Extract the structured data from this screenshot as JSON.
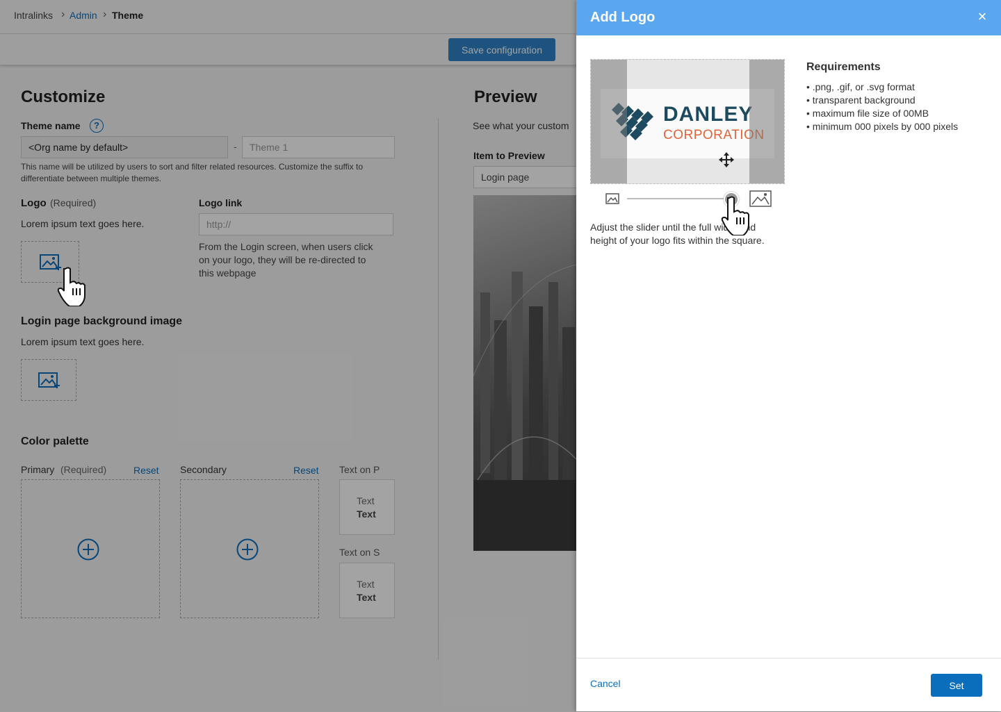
{
  "breadcrumb": {
    "root": "Intralinks",
    "admin": "Admin",
    "current": "Theme"
  },
  "toolbar": {
    "save_label": "Save configuration"
  },
  "customize": {
    "title": "Customize",
    "theme_name_label": "Theme name",
    "help_icon_text": "?",
    "theme_prefix_value": "<Org name by default>",
    "theme_separator": "-",
    "theme_suffix_placeholder": "Theme 1",
    "theme_help_line1": "This name will be utilized by users to sort and filter related resources. Customize the suffix to",
    "theme_help_line2": "differentiate between multiple themes.",
    "logo_label": "Logo",
    "logo_required": "(Required)",
    "logo_desc": "Lorem ipsum text goes here.",
    "logo_link_label": "Logo link",
    "logo_link_placeholder": "http://",
    "logo_link_help1": "From the Login screen, when users click",
    "logo_link_help2": "on your logo, they will be re-directed to",
    "logo_link_help3": "this webpage",
    "bg_label": "Login page background image",
    "bg_desc": "Lorem ipsum text goes here.",
    "palette_label": "Color palette",
    "primary_label": "Primary",
    "primary_required": "(Required)",
    "secondary_label": "Secondary",
    "reset_label": "Reset",
    "text_on_primary": "Text on P",
    "text_on_secondary": "Text on S",
    "sample_text": "Text",
    "sample_text_bold": "Text"
  },
  "preview": {
    "title": "Preview",
    "desc": "See what your custom",
    "item_label": "Item to Preview",
    "item_value": "Login page"
  },
  "modal": {
    "title": "Add Logo",
    "close": "×",
    "logo_word1": "DANLEY",
    "logo_word2": "CORPORATION",
    "req_title": "Requirements",
    "req_items": [
      "• .png, .gif, or .svg format",
      "• transparent background",
      "• maximum file size of 00MB",
      "• minimum 000 pixels by 000 pixels"
    ],
    "adjust_line1": "Adjust the slider until the full width and",
    "adjust_line2": "height of your logo fits within the square.",
    "cancel_label": "Cancel",
    "set_label": "Set"
  },
  "colors": {
    "accent": "#0a6ebd",
    "modal_header": "#5aa7f0",
    "logo_navy": "#1d4a5e",
    "logo_orange": "#e0643a"
  }
}
